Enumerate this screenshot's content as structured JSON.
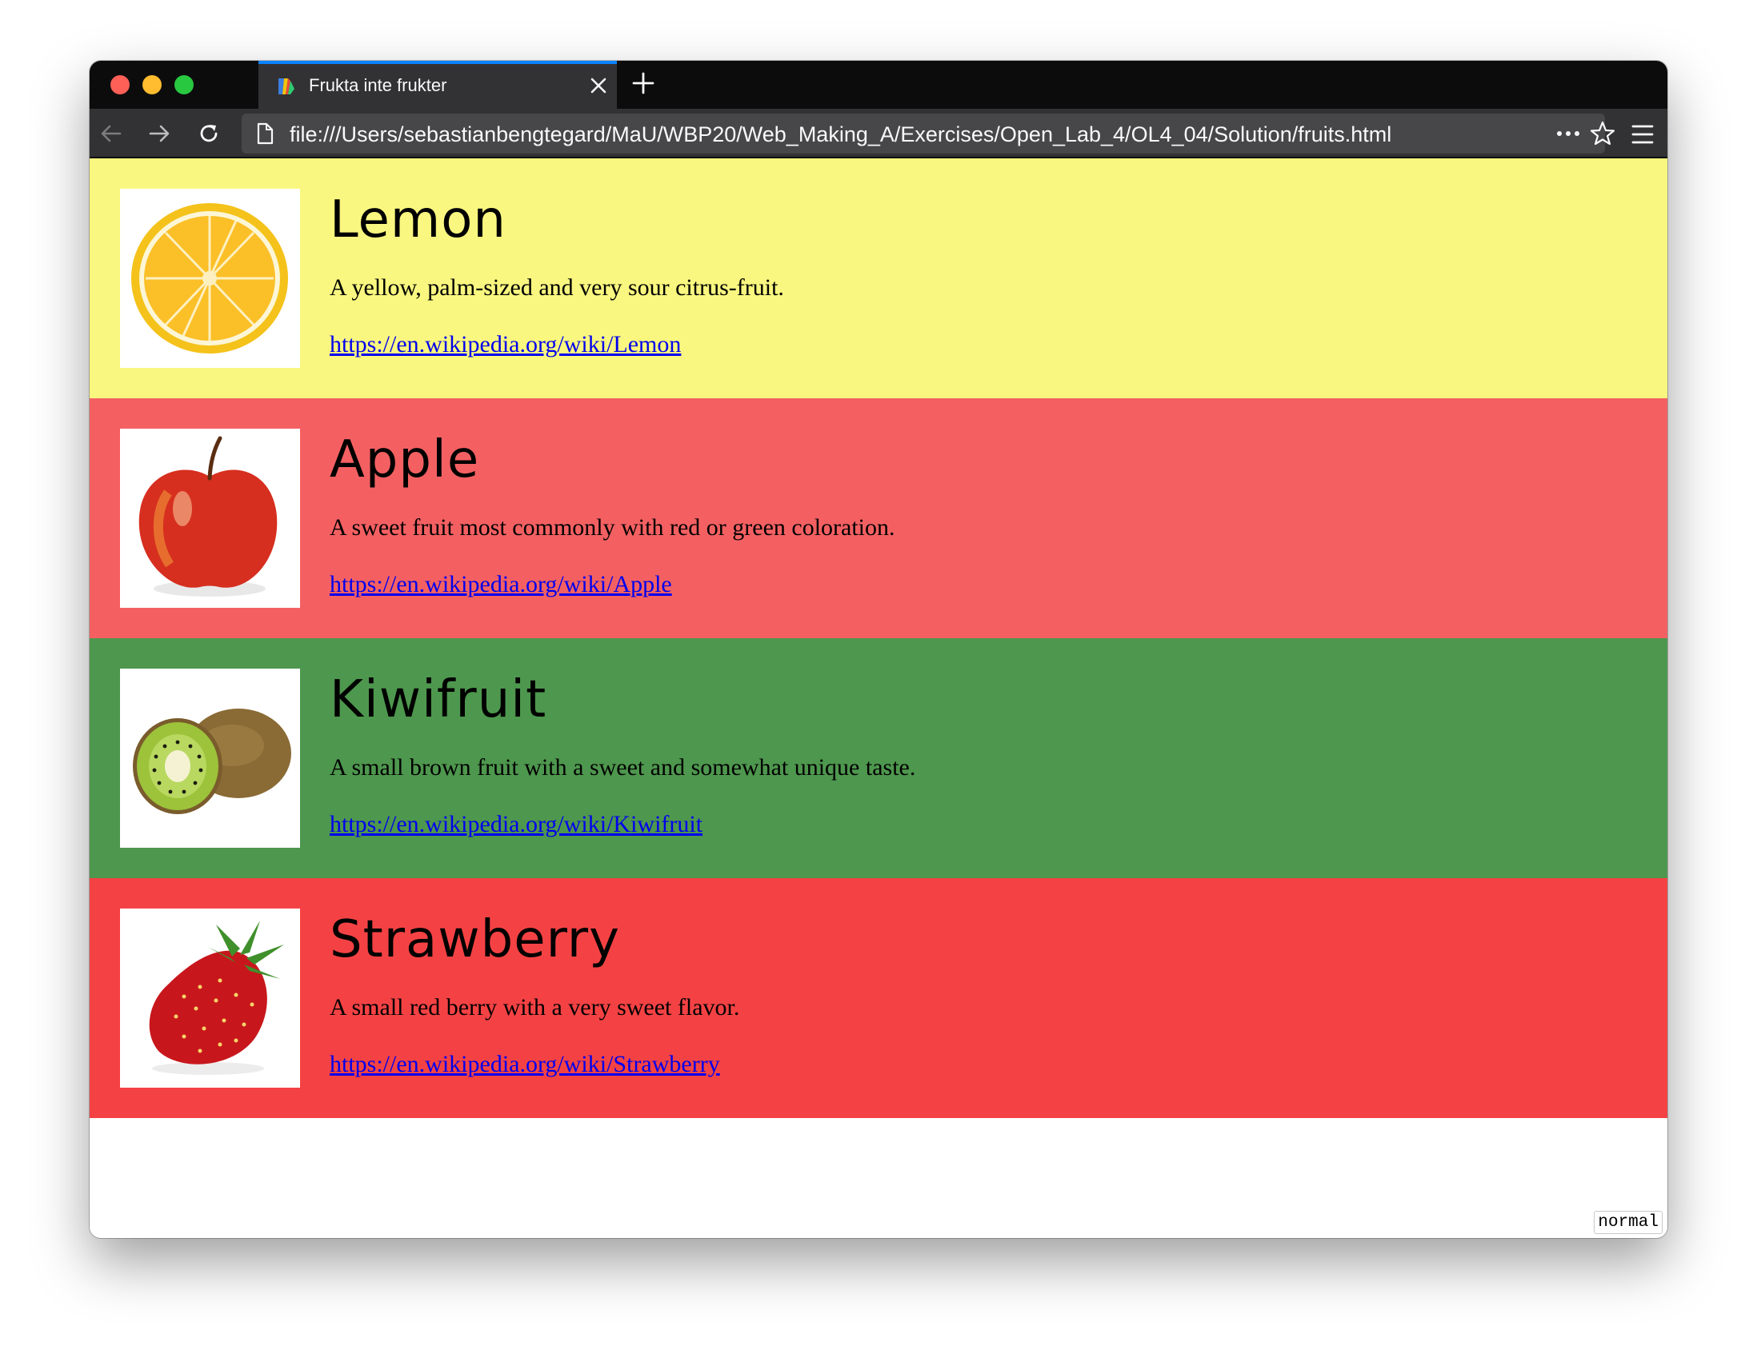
{
  "browser": {
    "tab_title": "Frukta inte frukter",
    "url": "file:///Users/sebastianbengtegard/MaU/WBP20/Web_Making_A/Exercises/Open_Lab_4/OL4_04/Solution/fruits.html",
    "accent_color": "#0a84ff"
  },
  "fruits": [
    {
      "name": "Lemon",
      "description": "A yellow, palm-sized and very sour citrus-fruit.",
      "link": "https://en.wikipedia.org/wiki/Lemon",
      "background": "#f9f77f",
      "image": "lemon-slice"
    },
    {
      "name": "Apple",
      "description": "A sweet fruit most commonly with red or green coloration.",
      "link": "https://en.wikipedia.org/wiki/Apple",
      "background": "#f46062",
      "image": "red-apple"
    },
    {
      "name": "Kiwifruit",
      "description": "A small brown fruit with a sweet and somewhat unique taste.",
      "link": "https://en.wikipedia.org/wiki/Kiwifruit",
      "background": "#4e974e",
      "image": "kiwi-halves"
    },
    {
      "name": "Strawberry",
      "description": "A small red berry with a very sweet flavor.",
      "link": "https://en.wikipedia.org/wiki/Strawberry",
      "background": "#f44244",
      "image": "strawberry"
    }
  ],
  "mode_badge": "normal"
}
